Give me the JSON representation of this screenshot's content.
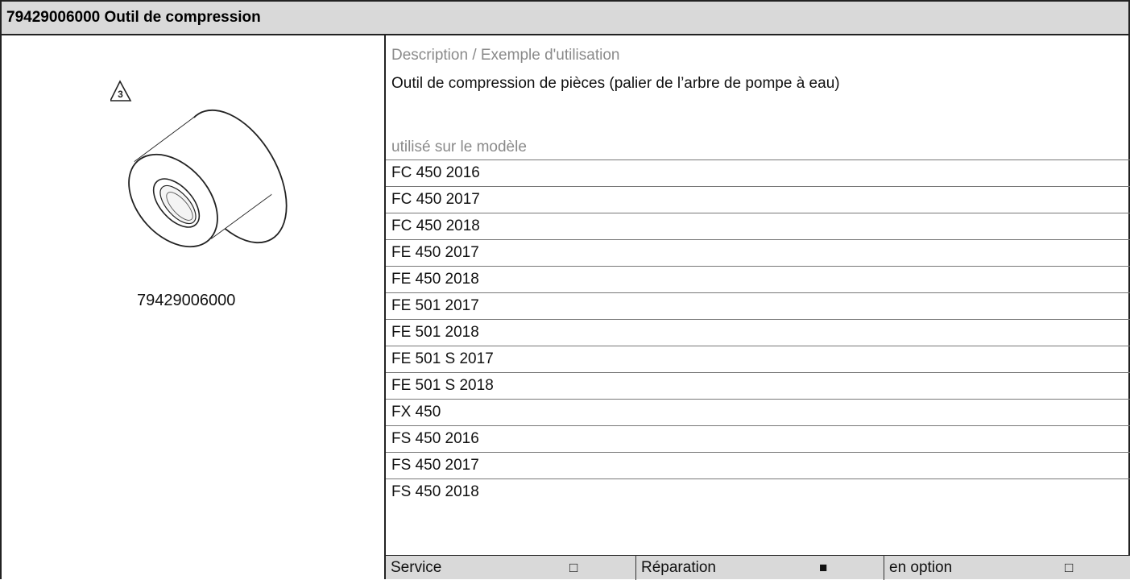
{
  "header": {
    "title": "79429006000 Outil de compression"
  },
  "left": {
    "warning_number": "3",
    "part_number": "79429006000"
  },
  "right": {
    "description_label": "Description / Exemple d'utilisation",
    "description_text": "Outil de compression de pièces (palier de l’arbre de pompe à eau)",
    "models_label": "utilisé sur le modèle",
    "models": [
      "FC 450 2016",
      "FC 450 2017",
      "FC 450 2018",
      "FE 450 2017",
      "FE 450 2018",
      "FE 501 2017",
      "FE 501 2018",
      "FE 501 S 2017",
      "FE 501 S 2018",
      "FX 450",
      "FS 450 2016",
      "FS 450 2017",
      "FS 450 2018"
    ]
  },
  "footer": {
    "items": [
      {
        "label": "Service",
        "box": "□"
      },
      {
        "label": "Réparation",
        "box": "■"
      },
      {
        "label": "en option",
        "box": "□"
      }
    ]
  }
}
